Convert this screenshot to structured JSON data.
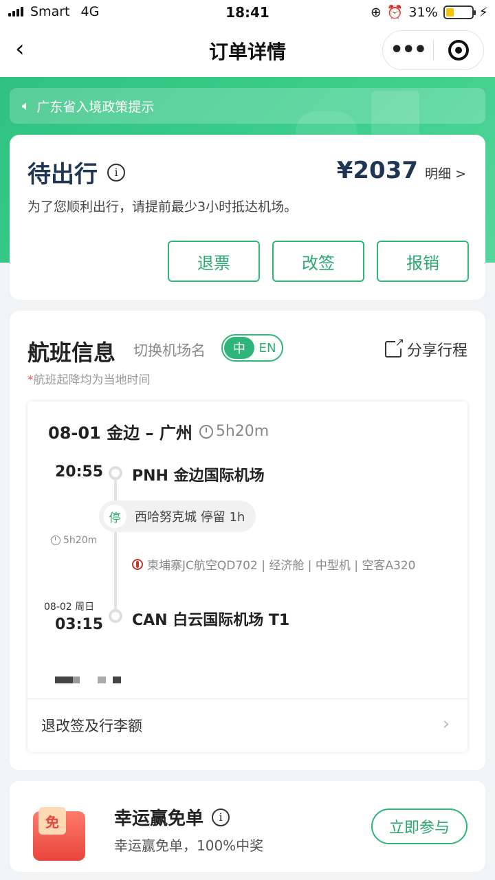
{
  "status_bar": {
    "carrier": "Smart",
    "network": "4G",
    "time": "18:41",
    "battery": "31%"
  },
  "nav": {
    "title": "订单详情"
  },
  "notice": {
    "text": "广东省入境政策提示"
  },
  "order": {
    "status": "待出行",
    "price": "¥2037",
    "price_detail": "明细 >",
    "hint": "为了您顺利出行，请提前最少3小时抵达机场。",
    "buttons": [
      "退票",
      "改签",
      "报销"
    ]
  },
  "flight": {
    "section_title": "航班信息",
    "switch_label": "切换机场名",
    "toggle_on": "中",
    "toggle_off": "EN",
    "share": "分享行程",
    "note": "航班起降均为当地时间",
    "route": "08-01 金边 – 广州",
    "duration": "5h20m",
    "dep_time": "20:55",
    "dep_airport": "PNH 金边国际机场",
    "stop_tag": "停",
    "stop_text": "西哈努克城 停留 1h",
    "mid_duration": "5h20m",
    "airline_info": "柬埔寨JC航空QD702 | 经济舱 | 中型机 | 空客A320",
    "arr_date": "08-02 周日",
    "arr_time": "03:15",
    "arr_airport": "CAN 白云国际机场 T1",
    "refund_link": "退改签及行李额"
  },
  "lucky": {
    "gift_label": "免",
    "title": "幸运赢免单",
    "subtitle": "幸运赢免单，100%中奖",
    "button": "立即参与"
  },
  "colors": {
    "accent": "#2db57a",
    "title_navy": "#1f3554"
  }
}
